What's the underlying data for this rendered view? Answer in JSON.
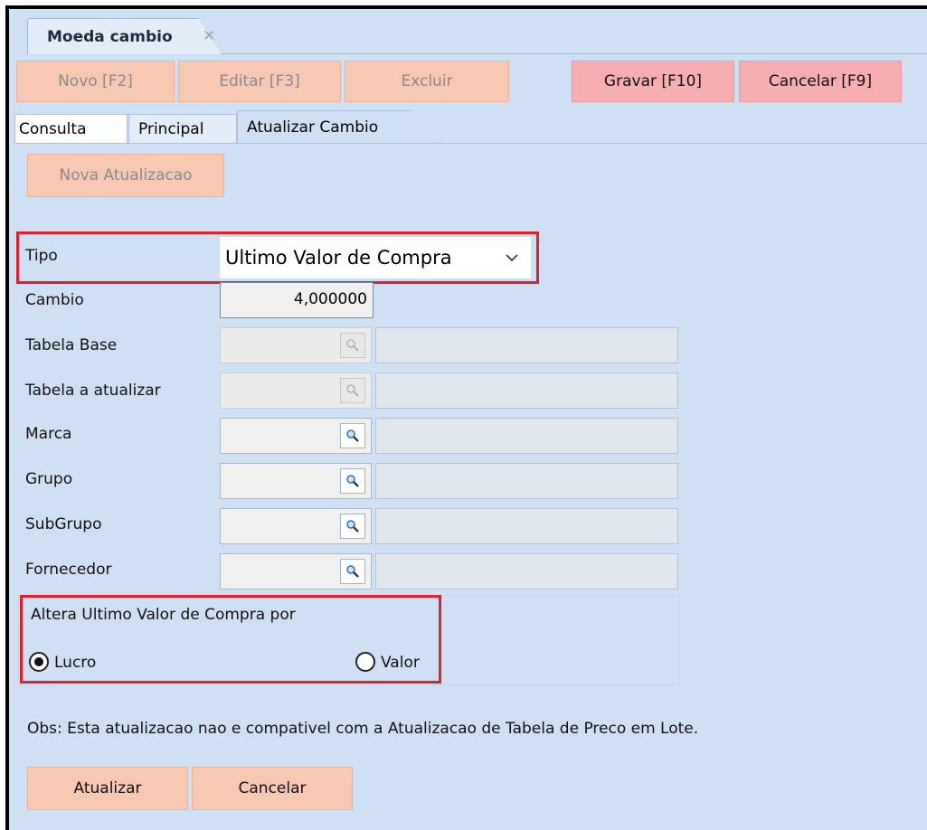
{
  "window": {
    "tab_title": "Moeda cambio",
    "close_glyph": "✕"
  },
  "toolbar": {
    "novo": "Novo [F2]",
    "editar": "Editar [F3]",
    "excluir": "Excluir",
    "gravar": "Gravar [F10]",
    "cancelar": "Cancelar [F9]"
  },
  "tabs": [
    "Consulta",
    "Principal",
    "Atualizar Cambio"
  ],
  "nova_atualizacao": "Nova Atualizacao",
  "form": {
    "tipo_label": "Tipo",
    "tipo_value": "Ultimo Valor de Compra",
    "cambio_label": "Cambio",
    "cambio_value": "4,000000",
    "tabela_base_label": "Tabela Base",
    "tabela_atualizar_label": "Tabela a atualizar",
    "marca_label": "Marca",
    "grupo_label": "Grupo",
    "subgrupo_label": "SubGrupo",
    "fornecedor_label": "Fornecedor"
  },
  "altera": {
    "title": "Altera Ultimo Valor de Compra por",
    "option_lucro": "Lucro",
    "option_valor": "Valor",
    "selected": "Lucro"
  },
  "obs": "Obs: Esta atualizacao nao e compativel com a Atualizacao de Tabela de Preco em Lote.",
  "actions": {
    "atualizar": "Atualizar",
    "cancelar": "Cancelar"
  },
  "colors": {
    "background": "#cfe0f5",
    "button": "#f7c9b3",
    "button_red": "#f7aeb0",
    "highlight": "#e0202a"
  },
  "icons": {
    "lookup": "magnifier-icon",
    "dropdown": "chevron-down-icon",
    "close": "close-icon"
  }
}
